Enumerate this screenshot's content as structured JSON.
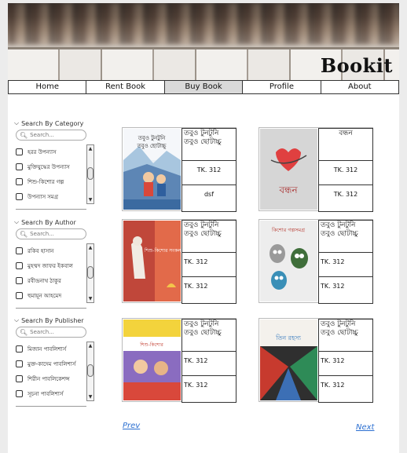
{
  "brand": "Bookit",
  "nav": [
    "Home",
    "Rent Book",
    "Buy Book",
    "Profile",
    "About"
  ],
  "nav_active": "Buy Book",
  "filters": [
    {
      "title": "Search By Category",
      "placeholder": "Search...",
      "items": [
        "হরর উপন্যাস",
        "মুক্তিযুদ্ধের উপন্যাস",
        "শিশু-কিশোর গল্প",
        "উপন্যাস সমগ্র"
      ]
    },
    {
      "title": "Search By Author",
      "placeholder": "Search...",
      "items": [
        "রকিব হাসান",
        "মুহম্মদ জাফর ইকবাল",
        "রবীন্দ্রনাথ ঠাকুর",
        "হুমায়ূন আহমেদ"
      ]
    },
    {
      "title": "Search By Publisher",
      "placeholder": "Search...",
      "items": [
        "মিজান পাবলিশার্স",
        "মুক্ত-কাদেম পাবলিশার্স",
        "শিরীন পাবলিকেশন্স",
        "সূচনা পাবলিশার্স"
      ]
    }
  ],
  "books": [
    {
      "title": "তবুও টুনটুনি তবুও ছোটাচ্চু",
      "price1": "TK. 312",
      "price2": "dsf",
      "center": true,
      "cover": "cover-1"
    },
    {
      "title": "বন্ধন",
      "price1": "TK. 312",
      "price2": "TK. 312",
      "center": true,
      "cover": "cover-2"
    },
    {
      "title": "তবুও টুনটুনি তবুও ছোটাচ্চু",
      "price1": "TK. 312",
      "price2": "TK. 312",
      "center": false,
      "cover": "cover-3"
    },
    {
      "title": "তবুও টুনটুনি তবুও ছোটাচ্চু",
      "price1": "TK. 312",
      "price2": "TK. 312",
      "center": false,
      "cover": "cover-4"
    },
    {
      "title": "তবুও টুনটুনি তবুও ছোটাচ্চু",
      "price1": "TK. 312",
      "price2": "TK. 312",
      "center": false,
      "cover": "cover-5"
    },
    {
      "title": "তবুও টুনটুনি তবুও ছোটাচ্চু",
      "price1": "TK. 312",
      "price2": "TK. 312",
      "center": false,
      "cover": "cover-6"
    }
  ],
  "covers": {
    "cover-1": {
      "line1": "তবুও টুনটুনি",
      "line2": "তবুও ছোটাচ্চু"
    },
    "cover-2": {
      "line1": "বন্ধন"
    },
    "cover-3": {
      "line1": "শিশু-কিশোর সংকলন"
    },
    "cover-4": {
      "line1": "কিশোর গল্পসমগ্র"
    },
    "cover-5": {
      "line1": "শিশু-কিশোর"
    },
    "cover-6": {
      "line1": "তিন রহস্য"
    }
  },
  "pager": {
    "prev": "Prev",
    "next": "Next"
  }
}
